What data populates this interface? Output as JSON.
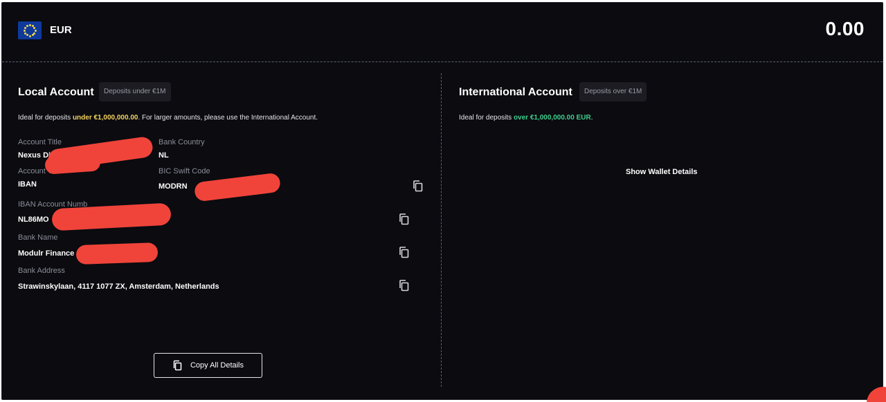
{
  "header": {
    "currency": "EUR",
    "balance": "0.00"
  },
  "local": {
    "title": "Local Account",
    "badge": "Deposits under €1M",
    "desc_prefix": "Ideal for deposits ",
    "desc_highlight": "under €1,000,000.00",
    "desc_suffix": ". For larger amounts, please use the International Account.",
    "fields": {
      "account_title": {
        "label": "Account Title",
        "value": "Nexus Di"
      },
      "bank_country": {
        "label": "Bank Country",
        "value": "NL"
      },
      "account_type": {
        "label": "Account T",
        "value": "IBAN"
      },
      "bic": {
        "label": "BIC Swift Code",
        "value": "MODRN"
      },
      "iban": {
        "label": "IBAN Account Numb",
        "value": "NL86MO"
      },
      "bank_name": {
        "label": "Bank Name",
        "value": "Modulr Finance"
      },
      "bank_address": {
        "label": "Bank Address",
        "value": "Strawinskylaan, 4117 1077 ZX, Amsterdam, Netherlands"
      }
    },
    "copy_all_label": "Copy All Details"
  },
  "international": {
    "title": "International Account",
    "badge": "Deposits over €1M",
    "desc_prefix": "Ideal for deposits ",
    "desc_highlight": "over €1,000,000.00 EUR",
    "desc_suffix": ".",
    "show_wallet_label": "Show Wallet Details"
  },
  "colors": {
    "background": "#0b0b10",
    "highlight_yellow": "#f4d35e",
    "highlight_green": "#3ecf8e",
    "redaction": "#f0443a"
  },
  "icons": {
    "flag": "eu-flag-icon",
    "copy": "copy-icon"
  }
}
